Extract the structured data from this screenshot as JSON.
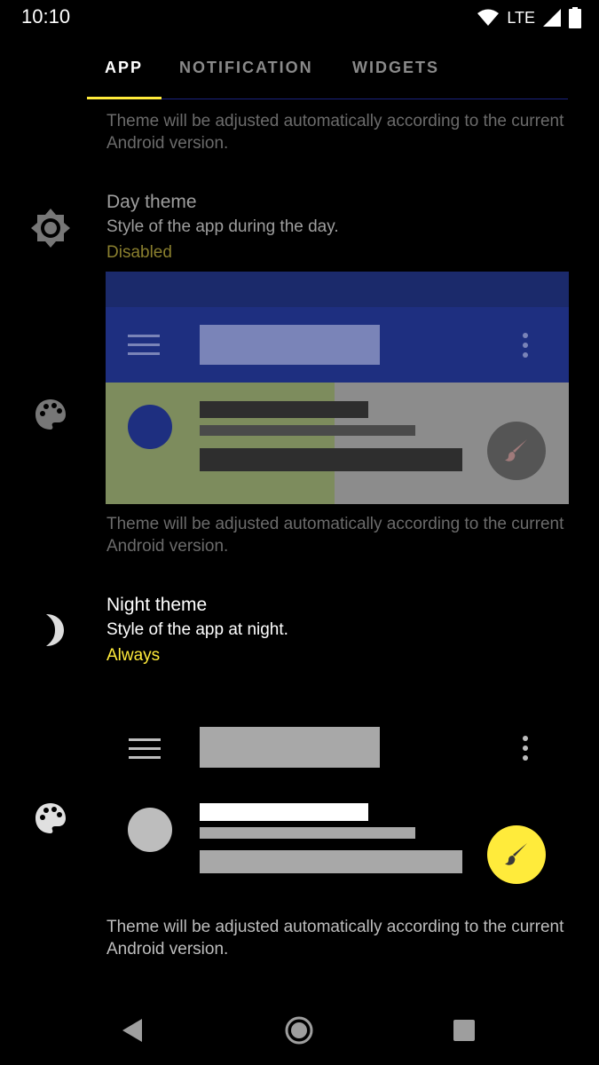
{
  "status_bar": {
    "time": "10:10",
    "network": "LTE",
    "icons": [
      "wifi-icon",
      "signal-icon",
      "battery-icon"
    ]
  },
  "tabs": [
    {
      "label": "APP",
      "active": true
    },
    {
      "label": "NOTIFICATION",
      "active": false
    },
    {
      "label": "WIDGETS",
      "active": false
    }
  ],
  "notes": {
    "top": "Theme will be adjusted automatically according to the current Android version.",
    "middle": "Theme will be adjusted automatically according to the current Android version.",
    "bottom": "Theme will be adjusted automatically according to the current Android version."
  },
  "day_theme": {
    "title": "Day theme",
    "subtitle": "Style of the app during the day.",
    "value": "Disabled",
    "icon": "brightness-icon",
    "preview_icon": "palette-icon"
  },
  "night_theme": {
    "title": "Night theme",
    "subtitle": "Style of the app at night.",
    "value": "Always",
    "icon": "moon-icon",
    "preview_icon": "palette-icon"
  },
  "colors": {
    "accent": "#ffeb3b",
    "disabled_value": "#8a7f2e",
    "day_primary": "#1e2f80",
    "tab_indicator": "#ffeb3b"
  },
  "nav": [
    "back-icon",
    "home-icon",
    "recents-icon"
  ]
}
